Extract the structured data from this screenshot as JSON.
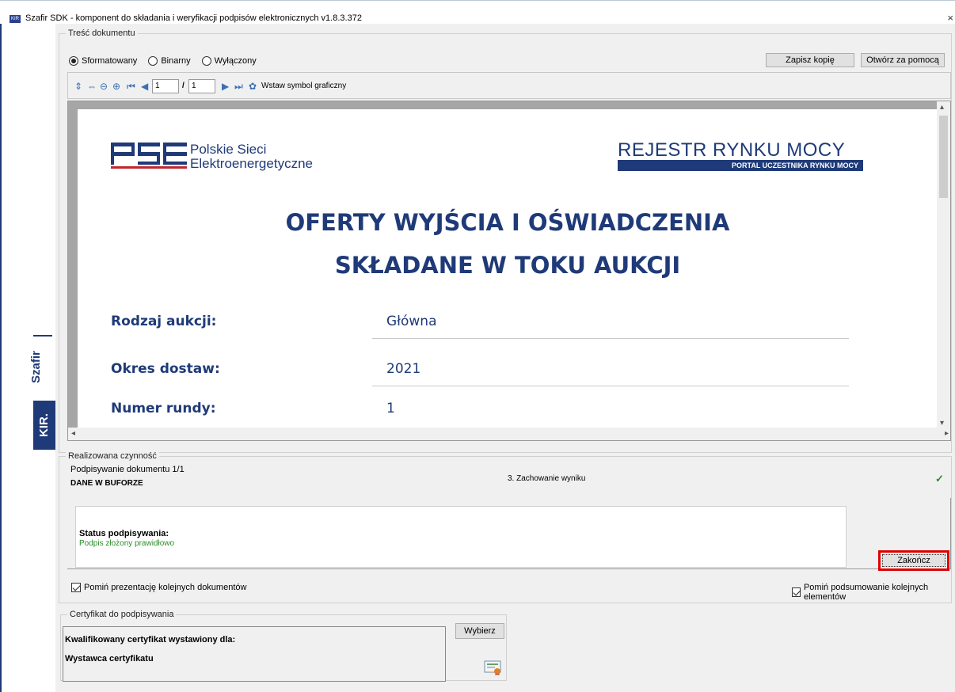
{
  "window": {
    "title": "Szafir SDK - komponent do składania i weryfikacji podpisów elektronicznych v1.8.3.372",
    "close_label": "×",
    "app_icon_label": "KIR"
  },
  "brand": {
    "name": "Szafir",
    "vendor": "KIR."
  },
  "document_content": {
    "legend": "Treść dokumentu",
    "modes": [
      {
        "label": "Sformatowany",
        "selected": true
      },
      {
        "label": "Binarny",
        "selected": false
      },
      {
        "label": "Wyłączony",
        "selected": false
      }
    ],
    "save_copy_label": "Zapisz kopię",
    "open_with_label": "Otwórz za pomocą"
  },
  "toolbar": {
    "page_current": "1",
    "page_separator": "/",
    "page_total": "1",
    "insert_symbol_label": "Wstaw symbol graficzny"
  },
  "document": {
    "pse_logo": {
      "line1": "Polskie Sieci",
      "line2": "Elektroenergetyczne"
    },
    "rrm_logo": {
      "title": "REJESTR RYNKU MOCY",
      "subtitle": "PORTAL UCZESTNIKA RYNKU MOCY"
    },
    "title_line1": "OFERTY WYJŚCIA I OŚWIADCZENIA",
    "title_line2": "SKŁADANE W TOKU AUKCJI",
    "fields": [
      {
        "label": "Rodzaj aukcji:",
        "value": "Główna"
      },
      {
        "label": "Okres dostaw:",
        "value": "2021"
      },
      {
        "label": "Numer rundy:",
        "value": "1"
      }
    ]
  },
  "activity": {
    "legend": "Realizowana czynność",
    "step_label": "Podpisywanie dokumentu 1/1",
    "buffer_label": "DANE W BUFORZE",
    "phase_label": "3. Zachowanie wyniku",
    "done_mark": "✓",
    "status_heading": "Status podpisywania:",
    "status_value": "Podpis złożony prawidłowo",
    "finish_label": "Zakończ",
    "status_color": "#2a8c2a",
    "highlight_color": "#e00000"
  },
  "options": {
    "skip_documents_label": "Pomiń prezentację kolejnych dokumentów",
    "skip_summary_label": "Pomiń podsumowanie kolejnych elementów"
  },
  "certificate": {
    "legend": "Certyfikat do podpisywania",
    "issued_for_label": "Kwalifikowany certyfikat wystawiony dla:",
    "issuer_label": "Wystawca certyfikatu",
    "choose_label": "Wybierz"
  }
}
